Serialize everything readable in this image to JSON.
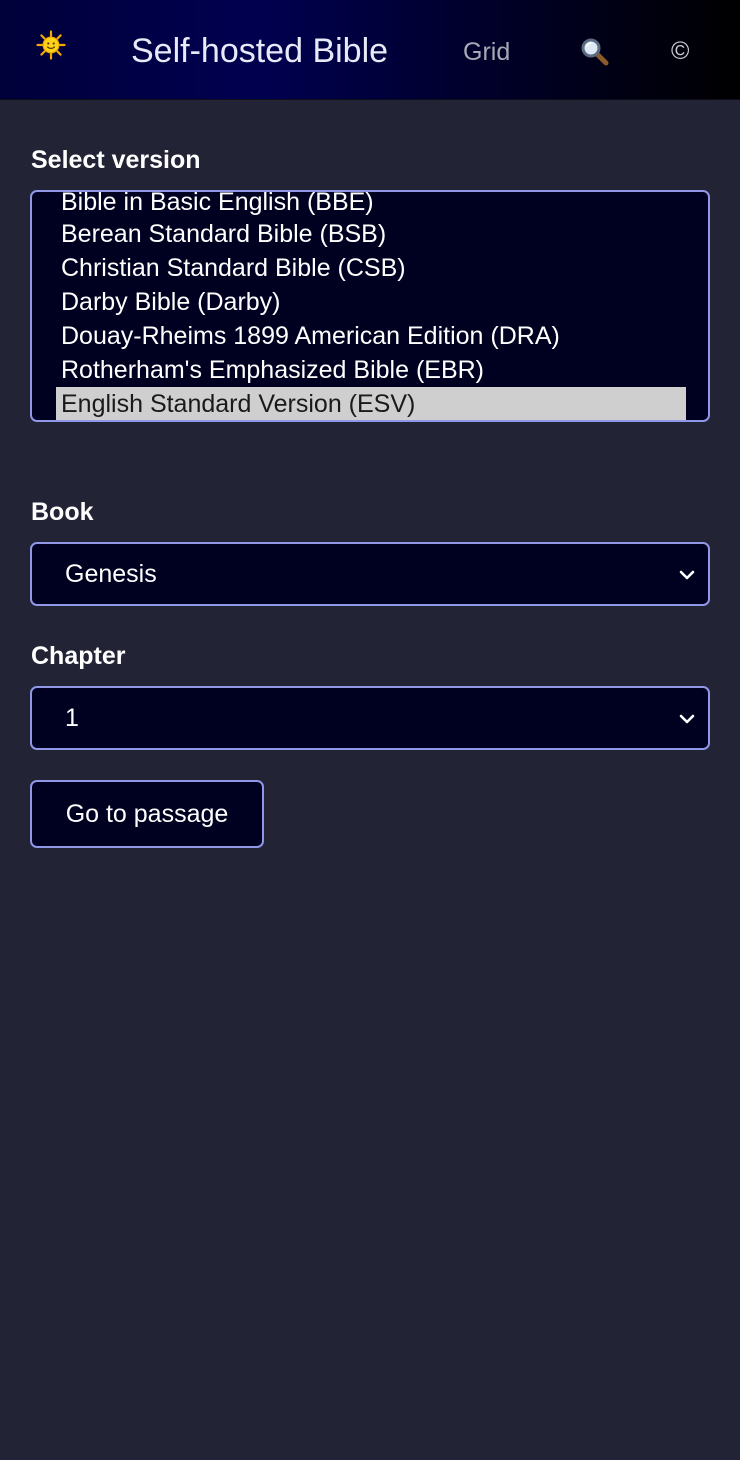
{
  "header": {
    "title": "Self-hosted Bible",
    "grid_label": "Grid",
    "copyright_symbol": "©",
    "logo_icon": "sun-icon",
    "search_icon": "search-icon"
  },
  "version_select": {
    "label": "Select version",
    "options": [
      "Bible in Basic English (BBE)",
      "Berean Standard Bible (BSB)",
      "Christian Standard Bible (CSB)",
      "Darby Bible (Darby)",
      "Douay-Rheims 1899 American Edition (DRA)",
      "Rotherham's Emphasized Bible (EBR)",
      "English Standard Version (ESV)"
    ],
    "selected": "English Standard Version (ESV)"
  },
  "book_select": {
    "label": "Book",
    "value": "Genesis"
  },
  "chapter_select": {
    "label": "Chapter",
    "value": "1"
  },
  "go_button": {
    "label": "Go to passage"
  },
  "colors": {
    "background": "#222435",
    "field_background": "#000020",
    "field_border": "#8f97e6",
    "selected_option": "#cfcfcf"
  }
}
